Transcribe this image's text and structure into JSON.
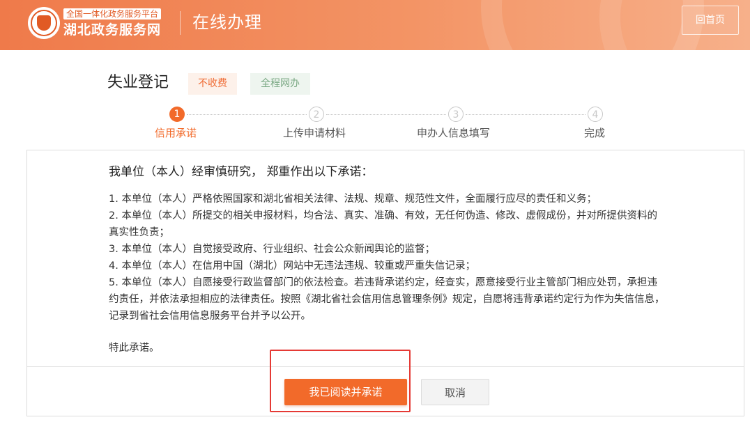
{
  "header": {
    "logo_subtitle": "全国一体化政务服务平台",
    "logo_title": "湖北政务服务网",
    "section_title": "在线办理",
    "home_label": "回首页"
  },
  "service": {
    "title": "失业登记",
    "tags": [
      "不收费",
      "全程网办"
    ]
  },
  "steps": [
    {
      "num": "1",
      "label": "信用承诺",
      "active": true
    },
    {
      "num": "2",
      "label": "上传申请材料",
      "active": false
    },
    {
      "num": "3",
      "label": "申办人信息填写",
      "active": false
    },
    {
      "num": "4",
      "label": "完成",
      "active": false
    }
  ],
  "pledge": {
    "intro": "我单位（本人）经审慎研究， 郑重作出以下承诺：",
    "clauses": [
      "1. 本单位（本人）严格依照国家和湖北省相关法律、法规、规章、规范性文件，全面履行应尽的责任和义务；",
      "2. 本单位（本人）所提交的相关申报材料，均合法、真实、准确、有效，无任何伪造、修改、虚假成份，并对所提供资料的真实性负责；",
      "3. 本单位（本人）自觉接受政府、行业组织、社会公众新闻舆论的监督；",
      "4. 本单位（本人）在信用中国（湖北）网站中无违法违规、较重或严重失信记录；",
      "5. 本单位（本人）自愿接受行政监督部门的依法检查。若违背承诺约定，经查实，愿意接受行业主管部门相应处罚，承担违约责任，并依法承担相应的法律责任。按照《湖北省社会信用信息管理条例》规定，自愿将违背承诺约定行为作为失信信息，记录到省社会信用信息服务平台并予以公开。"
    ],
    "closing": "特此承诺。"
  },
  "actions": {
    "agree_label": "我已阅读并承诺",
    "cancel_label": "取消"
  },
  "colors": {
    "accent": "#f26a2a",
    "header_start": "#ef7a4a",
    "highlight": "#e53a35"
  }
}
